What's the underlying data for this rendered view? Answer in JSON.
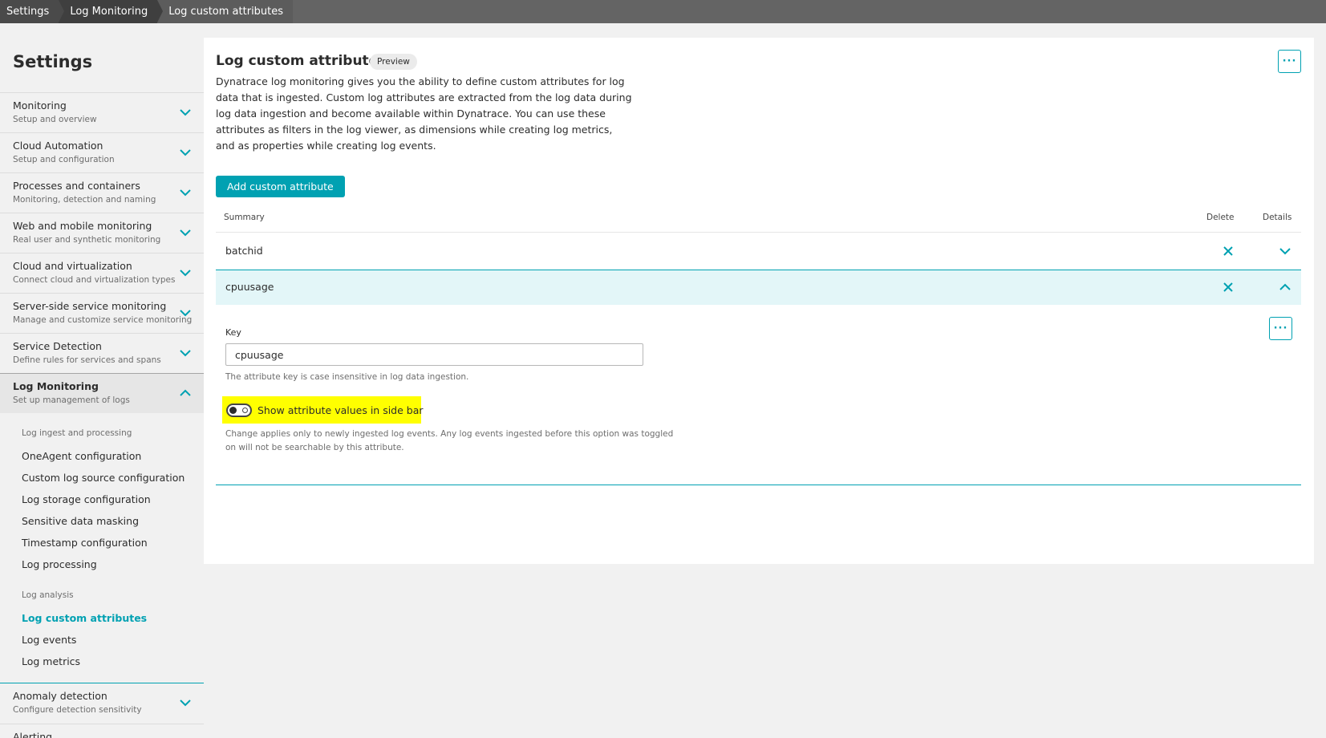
{
  "breadcrumb": [
    "Settings",
    "Log Monitoring",
    "Log custom attributes"
  ],
  "sidebar": {
    "title": "Settings",
    "groups": [
      {
        "title": "Monitoring",
        "subtitle": "Setup and overview"
      },
      {
        "title": "Cloud Automation",
        "subtitle": "Setup and configuration"
      },
      {
        "title": "Processes and containers",
        "subtitle": "Monitoring, detection and naming"
      },
      {
        "title": "Web and mobile monitoring",
        "subtitle": "Real user and synthetic monitoring"
      },
      {
        "title": "Cloud and virtualization",
        "subtitle": "Connect cloud and virtualization types"
      },
      {
        "title": "Server-side service monitoring",
        "subtitle": "Manage and customize service monitoring"
      },
      {
        "title": "Service Detection",
        "subtitle": "Define rules for services and spans"
      },
      {
        "title": "Log Monitoring",
        "subtitle": "Set up management of logs"
      },
      {
        "title": "Anomaly detection",
        "subtitle": "Configure detection sensitivity"
      },
      {
        "title": "Alerting",
        "subtitle": ""
      }
    ],
    "log_sections": [
      {
        "heading": "Log ingest and processing",
        "items": [
          "OneAgent configuration",
          "Custom log source configuration",
          "Log storage configuration",
          "Sensitive data masking",
          "Timestamp configuration",
          "Log processing"
        ]
      },
      {
        "heading": "Log analysis",
        "items": [
          "Log custom attributes",
          "Log events",
          "Log metrics"
        ]
      }
    ],
    "selected_item": "Log custom attributes"
  },
  "main": {
    "title": "Log custom attributes",
    "badge": "Preview",
    "description": "Dynatrace log monitoring gives you the ability to define custom attributes for log data that is ingested. Custom log attributes are extracted from the log data during log data ingestion and become available within Dynatrace. You can use these attributes as filters in the log viewer, as dimensions while creating log metrics, and as properties while creating log events.",
    "more_button": "···",
    "add_button": "Add custom attribute",
    "table": {
      "headers": {
        "summary": "Summary",
        "delete": "Delete",
        "details": "Details"
      },
      "rows": [
        {
          "summary": "batchid",
          "expanded": false
        },
        {
          "summary": "cpuusage",
          "expanded": true
        }
      ]
    },
    "detail": {
      "key_label": "Key",
      "key_value": "cpuusage",
      "key_hint": "The attribute key is case insensitive in log data ingestion.",
      "toggle_label": "Show attribute values in side bar",
      "toggle_on": false,
      "toggle_hint_line1": "Change applies only to newly ingested log events. Any log events ingested before this option was toggled",
      "toggle_hint_line2": "on will not be searchable by this attribute."
    }
  },
  "colors": {
    "accent": "#00a1b2",
    "highlight": "#ffff00",
    "row_expanded_bg": "#e3f6f8"
  },
  "icons": [
    "chevron-down-icon",
    "chevron-up-icon",
    "close-icon",
    "more-icon"
  ]
}
